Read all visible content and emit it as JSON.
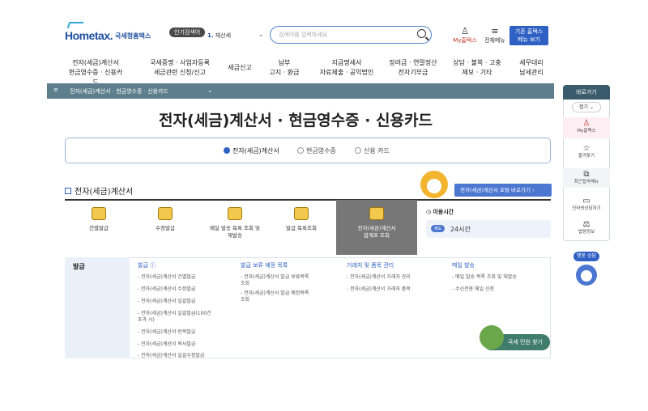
{
  "header": {
    "logo_mark": "Hometax.",
    "logo_text": "국세청홈택스",
    "popular_badge": "인기검색어",
    "popular_rank": "1.",
    "popular_term": "재산세",
    "search_placeholder": "검색어를 입력하세요",
    "my_home": "My홈택스",
    "all_menu": "전체메뉴",
    "old_home_line1": "기존 홈택스",
    "old_home_line2": "메뉴 보기"
  },
  "nav": [
    {
      "l1": "전자(세금)계산서",
      "l2": "현금영수증 · 신용카드"
    },
    {
      "l1": "국세증명 · 사업자등록",
      "l2": "세금관련 신청/신고"
    },
    {
      "l1": "세금신고",
      "l2": ""
    },
    {
      "l1": "납부",
      "l2": "고지 · 환급"
    },
    {
      "l1": "지급명세서",
      "l2": "자료제출 · 공익법인"
    },
    {
      "l1": "장려금 · 연말정산",
      "l2": "전자기부금"
    },
    {
      "l1": "상담 · 불복 · 고충",
      "l2": "제보 · 기타"
    },
    {
      "l1": "세무대리",
      "l2": "납세관리"
    }
  ],
  "breadcrumb": {
    "home": "≡",
    "current": "전자(세금)계산서 · 현금영수증 · 신용카드"
  },
  "page_title": "전자(세금)계산서 · 현금영수증 · 신용카드",
  "tabs": [
    "전자(세금)계산서",
    "현금영수증",
    "신용 카드"
  ],
  "section": {
    "title": "전자(세금)계산서",
    "shortcut": "전자(세금)계산서 포털 바로가기  ›"
  },
  "services": [
    {
      "label": "건별발급",
      "label2": ""
    },
    {
      "label": "수정발급",
      "label2": ""
    },
    {
      "label": "메일 발송 목록 조회 및",
      "label2": "재발송"
    },
    {
      "label": "발급 목록조회",
      "label2": ""
    },
    {
      "label": "전자(세금)계산서",
      "label2": "합계표 조회"
    }
  ],
  "hours": {
    "title": "이용시간",
    "badge": "제도",
    "value": "24시간"
  },
  "panel": {
    "label": "발급",
    "columns": [
      {
        "head": "발급 ⓘ",
        "items": [
          "- 전자(세금)계산서 건별발급",
          "- 전자(세금)계산서 수정발급",
          "- 전자(세금)계산서 일괄발급",
          "- 전자(세금)계산서 일괄발급(100건",
          "  초과 시)",
          "- 전자(세금)계산서 반복발급",
          "- 전자(세금)계산서 복사발급",
          "- 전자(세금)계산서 일괄수정발급"
        ]
      },
      {
        "head": "발급 보류 예정 목록",
        "items": [
          "- 전자(세금)계산서 발급 보류목록",
          "  조회",
          "- 전자(세금)계산서 발급 예정목록",
          "  조회"
        ]
      },
      {
        "head": "거래처 및 품목 관리",
        "items": [
          "- 전자(세금)계산서 거래처 관리",
          "- 전자(세금)계산서 거래처 품목"
        ]
      },
      {
        "head": "메일 발송",
        "items": [
          "- 메일 발송 목록 조회 및 재발송",
          "- 수신전용 메일 신청"
        ]
      }
    ],
    "civil_button": "국세 민원 찾기"
  },
  "quick_menu": {
    "head": "바로가기",
    "fold": "접기 ⌄",
    "items": [
      {
        "icon": "person-icon",
        "glyph": "♙",
        "label": "My홈택스"
      },
      {
        "icon": "star-icon",
        "glyph": "☆",
        "label": "즐겨찾기"
      },
      {
        "icon": "recent-icon",
        "glyph": "⧉",
        "label": "최근접속메뉴"
      },
      {
        "icon": "monitor-icon",
        "glyph": "▭",
        "label": "인터넷상담하기"
      },
      {
        "icon": "law-icon",
        "glyph": "⚖",
        "label": "법령정보"
      }
    ],
    "chatbot_badge": "챗봇 상담"
  }
}
